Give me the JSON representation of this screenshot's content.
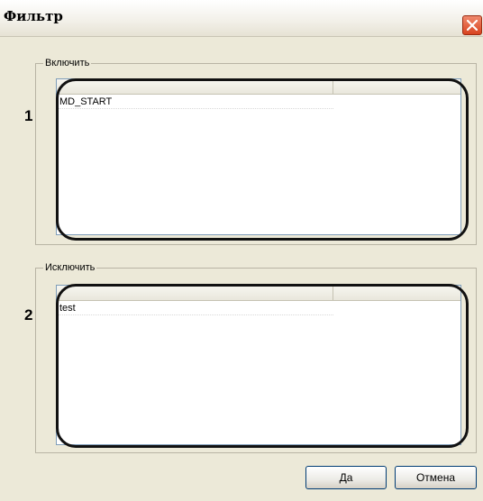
{
  "window": {
    "title": "Фильтр",
    "close_icon": "close-icon",
    "accent": "#d8431f"
  },
  "include_group": {
    "legend": "Включить",
    "callout_number": "1",
    "rows": [
      "MD_START"
    ]
  },
  "exclude_group": {
    "legend": "Исключить",
    "callout_number": "2",
    "rows": [
      "test"
    ]
  },
  "buttons": {
    "ok_label": "Да",
    "cancel_label": "Отмена"
  }
}
